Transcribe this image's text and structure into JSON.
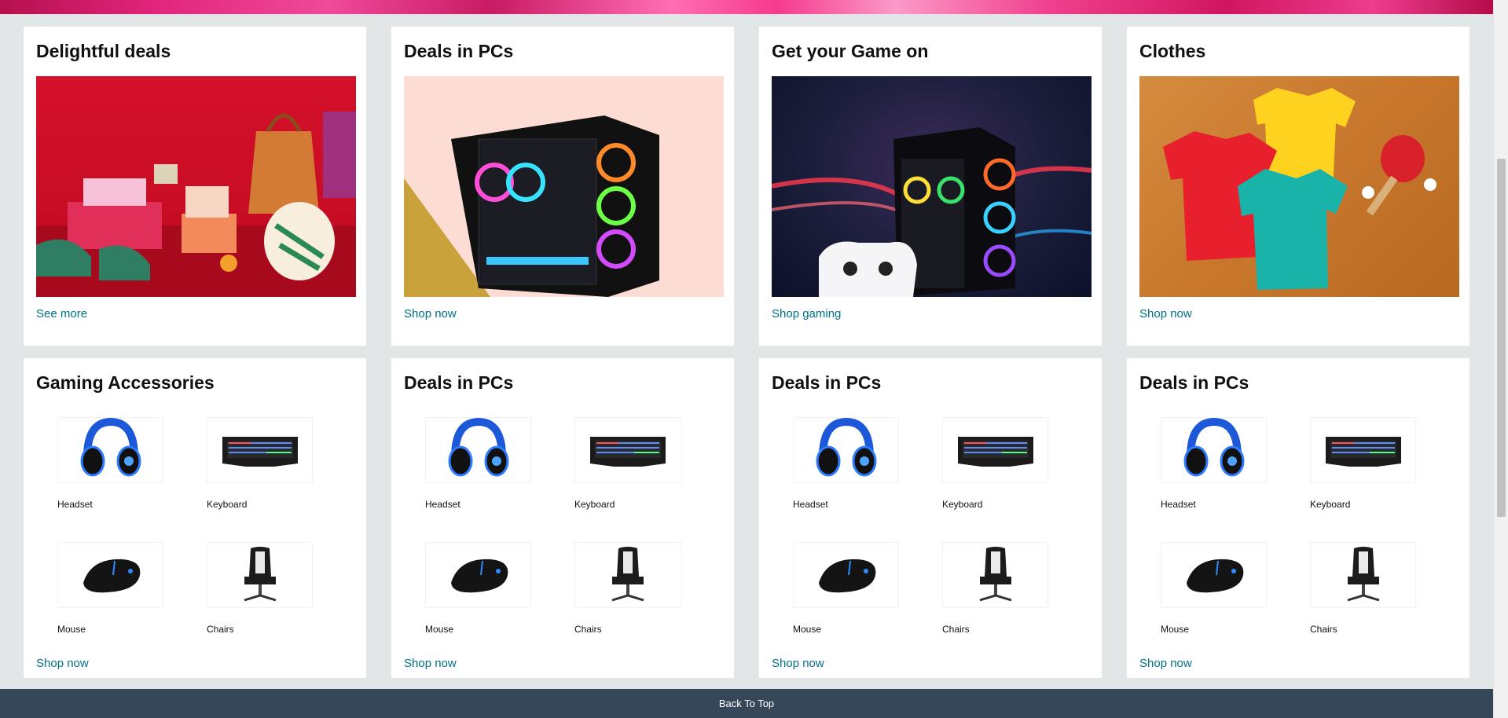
{
  "row1": [
    {
      "title": "Delightful deals",
      "link": "See more",
      "image_icon": "gift-products-image"
    },
    {
      "title": "Deals in PCs",
      "link": "Shop now",
      "image_icon": "pc-case-image"
    },
    {
      "title": "Get your Game on",
      "link": "Shop gaming",
      "image_icon": "gaming-pc-image"
    },
    {
      "title": "Clothes",
      "link": "Shop now",
      "image_icon": "tshirts-image"
    }
  ],
  "row2": [
    {
      "title": "Gaming Accessories",
      "link": "Shop now",
      "tiles": [
        {
          "label": "Headset",
          "icon": "headset-icon"
        },
        {
          "label": "Keyboard",
          "icon": "keyboard-icon"
        },
        {
          "label": "Mouse",
          "icon": "mouse-icon"
        },
        {
          "label": "Chairs",
          "icon": "gaming-chair-icon"
        }
      ]
    },
    {
      "title": "Deals in PCs",
      "link": "Shop now",
      "tiles": [
        {
          "label": "Headset",
          "icon": "headset-icon"
        },
        {
          "label": "Keyboard",
          "icon": "keyboard-icon"
        },
        {
          "label": "Mouse",
          "icon": "mouse-icon"
        },
        {
          "label": "Chairs",
          "icon": "gaming-chair-icon"
        }
      ]
    },
    {
      "title": "Deals in PCs",
      "link": "Shop now",
      "tiles": [
        {
          "label": "Headset",
          "icon": "headset-icon"
        },
        {
          "label": "Keyboard",
          "icon": "keyboard-icon"
        },
        {
          "label": "Mouse",
          "icon": "mouse-icon"
        },
        {
          "label": "Chairs",
          "icon": "gaming-chair-icon"
        }
      ]
    },
    {
      "title": "Deals in PCs",
      "link": "Shop now",
      "tiles": [
        {
          "label": "Headset",
          "icon": "headset-icon"
        },
        {
          "label": "Keyboard",
          "icon": "keyboard-icon"
        },
        {
          "label": "Mouse",
          "icon": "mouse-icon"
        },
        {
          "label": "Chairs",
          "icon": "gaming-chair-icon"
        }
      ]
    }
  ],
  "footer": {
    "back_to_top": "Back To Top"
  },
  "colors": {
    "link": "#007185",
    "background": "#e3e6e6",
    "footer": "#37475a"
  }
}
